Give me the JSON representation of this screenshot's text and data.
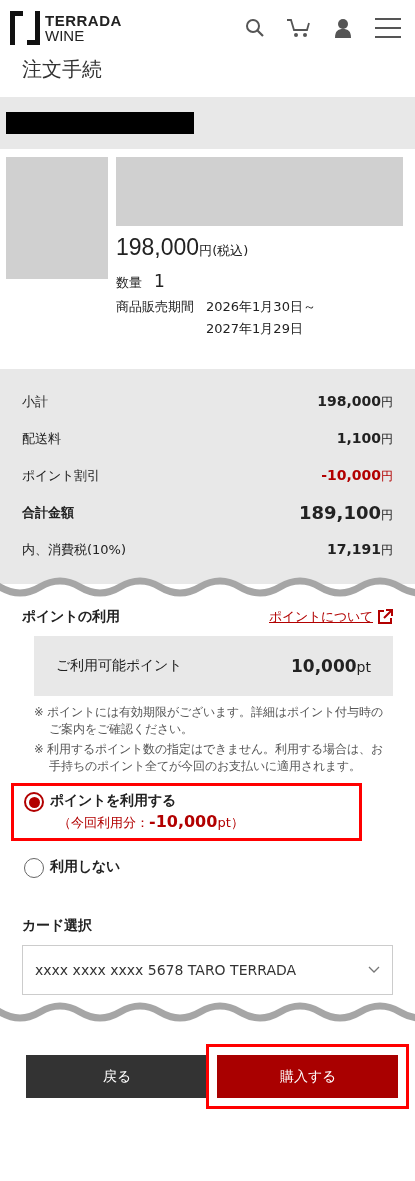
{
  "header": {
    "logo": {
      "line1": "TERRADA",
      "line2": "WINE"
    },
    "page_title": "注文手続"
  },
  "product": {
    "price": "198,000",
    "currency": "円",
    "tax_note": "(税込)",
    "quantity_label": "数量",
    "quantity": "1",
    "period_label": "商品販売期間",
    "period_lines": [
      "2026年1月30日～",
      "2027年1月29日"
    ]
  },
  "summary": {
    "rows": [
      {
        "label": "小計",
        "amount": "198,000",
        "unit": "円",
        "kind": "normal"
      },
      {
        "label": "配送料",
        "amount": "1,100",
        "unit": "円",
        "kind": "normal"
      },
      {
        "label": "ポイント割引",
        "amount": "-10,000",
        "unit": "円",
        "kind": "discount"
      },
      {
        "label": "合計金額",
        "amount": "189,100",
        "unit": "円",
        "kind": "total"
      },
      {
        "label": "内、消費税(10%)",
        "amount": "17,191",
        "unit": "円",
        "kind": "normal"
      }
    ]
  },
  "points": {
    "title": "ポイントの利用",
    "link": "ポイントについて",
    "available_label": "ご利用可能ポイント",
    "available_amount": "10,000",
    "available_unit": "pt",
    "notes": [
      "※ ポイントには有効期限がございます。詳細はポイント付与時のご案内をご確認ください。",
      "※ 利用するポイント数の指定はできません。利用する場合は、お手持ちのポイント全てが今回のお支払いに適用されます。"
    ],
    "options": [
      {
        "label": "ポイントを利用する",
        "sub": "（今回利用分：**-10,000**pt）",
        "selected": true,
        "highlighted": true
      },
      {
        "label": "利用しない",
        "selected": false,
        "highlighted": false
      }
    ]
  },
  "card": {
    "label": "カード選択",
    "value": "xxxx xxxx xxxx 5678 TARO TERRADA"
  },
  "buttons": [
    {
      "label": "戻る",
      "kind": "back",
      "highlighted": false
    },
    {
      "label": "購入する",
      "kind": "purchase",
      "highlighted": true
    }
  ]
}
